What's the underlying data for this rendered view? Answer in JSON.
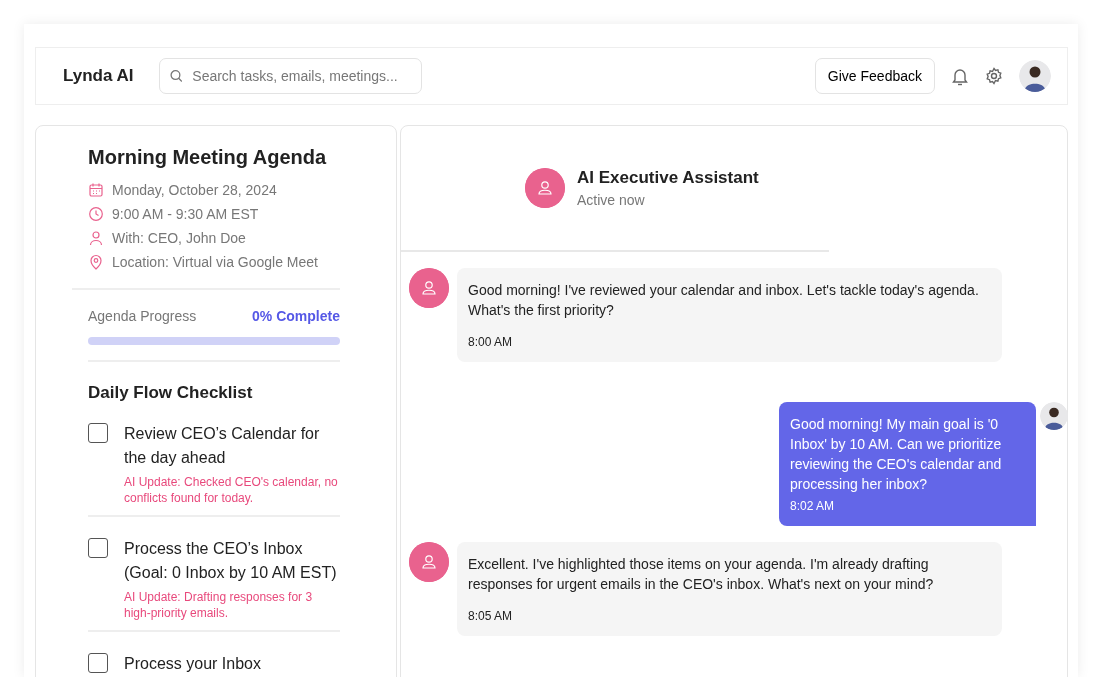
{
  "header": {
    "brand": "Lynda AI",
    "search": {
      "placeholder": "Search tasks, emails, meetings..."
    },
    "feedback_button": "Give Feedback"
  },
  "agenda": {
    "title": "Morning Meeting Agenda",
    "details": [
      {
        "kind": "date",
        "text": "Monday, October 28, 2024"
      },
      {
        "kind": "time",
        "text": "9:00 AM - 9:30 AM EST"
      },
      {
        "kind": "person",
        "text": "With: CEO, John Doe"
      },
      {
        "kind": "location",
        "text": "Location: Virtual via Google Meet"
      }
    ],
    "progress": {
      "label": "Agenda Progress",
      "reading": "0% Complete",
      "level": 0
    }
  },
  "checklist": {
    "title": "Daily Flow Checklist",
    "items": [
      {
        "label": "Review CEO’s Calendar for the day ahead",
        "checked": false,
        "note": "AI Update: Checked CEO's calendar, no conflicts found for today."
      },
      {
        "label": "Process the CEO’s Inbox (Goal: 0 Inbox by 10 AM EST)",
        "checked": false,
        "note": "AI Update: Drafting responses for 3 high-priority emails."
      },
      {
        "label": "Process your Inbox",
        "checked": false
      }
    ]
  },
  "chat": {
    "title": "AI Executive Assistant",
    "status": "Active now",
    "messages": [
      {
        "kind": "assistant",
        "text": "Good morning! I've reviewed your calendar and inbox. Let's tackle today's agenda. What's the first priority?",
        "time": "8:00 AM"
      },
      {
        "kind": "user",
        "text": "Good morning! My main goal is '0 Inbox' by 10 AM. Can we prioritize reviewing the CEO's calendar and processing her inbox?",
        "time": "8:02 AM"
      },
      {
        "kind": "assistant",
        "text": "Excellent. I've highlighted those items on your agenda. I'm already drafting responses for urgent emails in the CEO's inbox. What's next on your mind?",
        "time": "8:05 AM"
      }
    ]
  }
}
